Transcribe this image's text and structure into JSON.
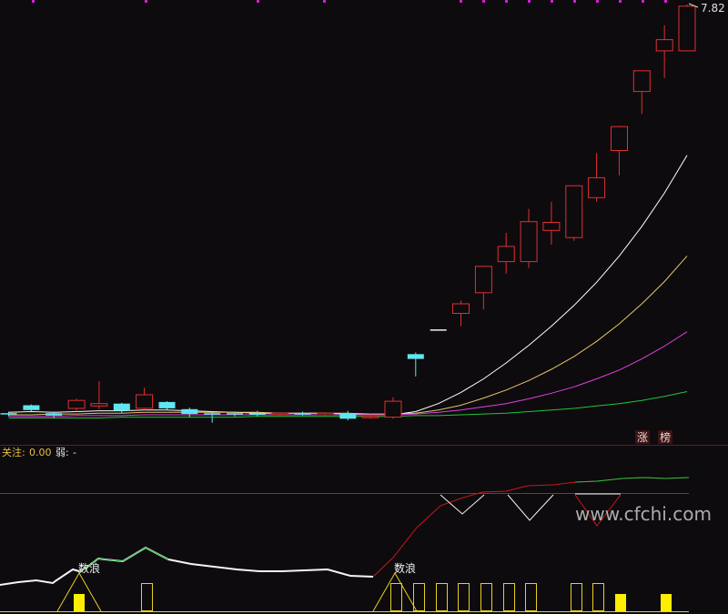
{
  "chart_data": {
    "type": "candlestick",
    "price_high_label": "7.82",
    "main_panel": {
      "candles": [
        {
          "o": 2.69,
          "h": 2.72,
          "l": 2.66,
          "c": 2.7,
          "color": "cyan"
        },
        {
          "o": 2.8,
          "h": 2.81,
          "l": 2.72,
          "c": 2.74,
          "color": "cyan"
        },
        {
          "o": 2.7,
          "h": 2.72,
          "l": 2.64,
          "c": 2.67,
          "color": "cyan"
        },
        {
          "o": 2.76,
          "h": 2.88,
          "l": 2.72,
          "c": 2.86,
          "color": "red"
        },
        {
          "o": 2.79,
          "h": 3.1,
          "l": 2.75,
          "c": 2.82,
          "color": "red"
        },
        {
          "o": 2.82,
          "h": 2.83,
          "l": 2.7,
          "c": 2.73,
          "color": "cyan"
        },
        {
          "o": 2.76,
          "h": 3.02,
          "l": 2.74,
          "c": 2.93,
          "color": "red"
        },
        {
          "o": 2.84,
          "h": 2.85,
          "l": 2.74,
          "c": 2.76,
          "color": "cyan"
        },
        {
          "o": 2.75,
          "h": 2.77,
          "l": 2.65,
          "c": 2.69,
          "color": "cyan"
        },
        {
          "o": 2.7,
          "h": 2.72,
          "l": 2.58,
          "c": 2.69,
          "color": "cyan"
        },
        {
          "o": 2.69,
          "h": 2.72,
          "l": 2.66,
          "c": 2.7,
          "color": "cyan"
        },
        {
          "o": 2.7,
          "h": 2.73,
          "l": 2.66,
          "c": 2.68,
          "color": "cyan"
        },
        {
          "o": 2.69,
          "h": 2.71,
          "l": 2.66,
          "c": 2.7,
          "color": "red"
        },
        {
          "o": 2.7,
          "h": 2.72,
          "l": 2.67,
          "c": 2.69,
          "color": "cyan"
        },
        {
          "o": 2.68,
          "h": 2.7,
          "l": 2.65,
          "c": 2.7,
          "color": "red"
        },
        {
          "o": 2.7,
          "h": 2.73,
          "l": 2.61,
          "c": 2.63,
          "color": "cyan"
        },
        {
          "o": 2.66,
          "h": 2.69,
          "l": 2.63,
          "c": 2.65,
          "color": "red"
        },
        {
          "o": 2.65,
          "h": 2.9,
          "l": 2.63,
          "c": 2.85,
          "color": "red"
        },
        {
          "o": 3.44,
          "h": 3.46,
          "l": 3.16,
          "c": 3.38,
          "color": "cyan"
        },
        {
          "o": 3.75,
          "h": 3.75,
          "l": 3.75,
          "c": 3.75,
          "color": "white"
        },
        {
          "o": 4.07,
          "h": 4.11,
          "l": 3.79,
          "c": 3.95,
          "color": "red"
        },
        {
          "o": 4.21,
          "h": 4.34,
          "l": 4.0,
          "c": 4.54,
          "color": "red"
        },
        {
          "o": 4.6,
          "h": 4.96,
          "l": 4.45,
          "c": 4.79,
          "color": "red"
        },
        {
          "o": 4.6,
          "h": 5.26,
          "l": 4.52,
          "c": 5.1,
          "color": "red"
        },
        {
          "o": 4.99,
          "h": 5.35,
          "l": 4.81,
          "c": 5.09,
          "color": "red"
        },
        {
          "o": 4.9,
          "h": 5.55,
          "l": 4.86,
          "c": 5.55,
          "color": "red"
        },
        {
          "o": 5.4,
          "h": 5.96,
          "l": 5.35,
          "c": 5.65,
          "color": "red"
        },
        {
          "o": 5.99,
          "h": 6.3,
          "l": 5.68,
          "c": 6.29,
          "color": "red"
        },
        {
          "o": 6.73,
          "h": 6.93,
          "l": 6.45,
          "c": 6.99,
          "color": "red"
        },
        {
          "o": 7.24,
          "h": 7.56,
          "l": 6.9,
          "c": 7.38,
          "color": "red"
        },
        {
          "o": 7.24,
          "h": 7.82,
          "l": 7.24,
          "c": 7.8,
          "color": "red"
        }
      ],
      "ma_lines": [
        {
          "color": "#ffffff",
          "values": [
            2.71,
            2.72,
            2.71,
            2.72,
            2.73,
            2.73,
            2.74,
            2.74,
            2.73,
            2.72,
            2.71,
            2.7,
            2.7,
            2.7,
            2.7,
            2.69,
            2.68,
            2.68,
            2.72,
            2.82,
            2.96,
            3.13,
            3.33,
            3.55,
            3.79,
            4.05,
            4.34,
            4.67,
            5.04,
            5.46,
            5.93
          ]
        },
        {
          "color": "#e8c46a",
          "values": [
            2.68,
            2.68,
            2.69,
            2.69,
            2.7,
            2.7,
            2.71,
            2.71,
            2.71,
            2.71,
            2.71,
            2.71,
            2.7,
            2.7,
            2.7,
            2.7,
            2.69,
            2.69,
            2.7,
            2.74,
            2.8,
            2.89,
            2.99,
            3.11,
            3.25,
            3.41,
            3.6,
            3.82,
            4.07,
            4.35,
            4.67
          ]
        },
        {
          "color": "#e040e0",
          "values": [
            2.66,
            2.66,
            2.66,
            2.67,
            2.67,
            2.67,
            2.68,
            2.68,
            2.68,
            2.68,
            2.68,
            2.68,
            2.68,
            2.68,
            2.68,
            2.68,
            2.68,
            2.68,
            2.69,
            2.71,
            2.74,
            2.78,
            2.82,
            2.88,
            2.95,
            3.03,
            3.13,
            3.24,
            3.38,
            3.54,
            3.72
          ]
        },
        {
          "color": "#22c43a",
          "values": [
            2.64,
            2.64,
            2.64,
            2.64,
            2.64,
            2.65,
            2.65,
            2.65,
            2.65,
            2.65,
            2.65,
            2.66,
            2.66,
            2.66,
            2.66,
            2.66,
            2.66,
            2.66,
            2.67,
            2.67,
            2.68,
            2.69,
            2.7,
            2.72,
            2.74,
            2.76,
            2.79,
            2.82,
            2.86,
            2.91,
            2.97
          ]
        }
      ],
      "stock_title_chars": [
        "涨",
        "榜"
      ]
    },
    "sub_panel": {
      "header_prefix": "关注:",
      "header_value": "0.00",
      "header_suffix": "弱:",
      "header_suffix_value": "-",
      "annotation_labels": [
        "数浪",
        "数浪"
      ],
      "watermark": "www.cfchi.com"
    }
  }
}
